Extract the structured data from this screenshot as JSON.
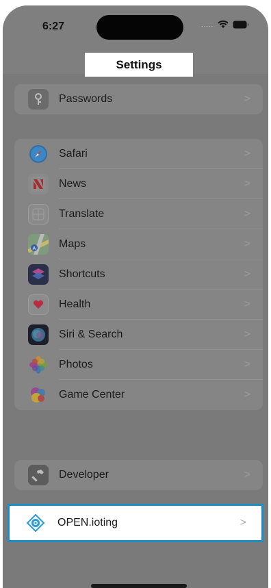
{
  "status_bar": {
    "time": "6:27",
    "signal": "....."
  },
  "nav": {
    "title": "Settings"
  },
  "groups": {
    "passwords": {
      "label": "Passwords",
      "icon": "key-icon"
    },
    "apps": [
      {
        "label": "Safari",
        "icon": "safari-icon"
      },
      {
        "label": "News",
        "icon": "news-icon"
      },
      {
        "label": "Translate",
        "icon": "translate-icon"
      },
      {
        "label": "Maps",
        "icon": "maps-icon"
      },
      {
        "label": "Shortcuts",
        "icon": "shortcuts-icon"
      },
      {
        "label": "Health",
        "icon": "health-icon"
      },
      {
        "label": "Siri & Search",
        "icon": "siri-icon"
      },
      {
        "label": "Photos",
        "icon": "photos-icon"
      },
      {
        "label": "Game Center",
        "icon": "game-center-icon"
      }
    ],
    "developer": {
      "label": "Developer",
      "icon": "hammer-icon"
    },
    "thirdparty": {
      "label": "OPEN.ioting",
      "icon": "open-ioting-icon"
    }
  },
  "chevron": ">",
  "colors": {
    "highlight_border": "#1e8ec7",
    "dim_overlay": "#7a7a7a"
  }
}
